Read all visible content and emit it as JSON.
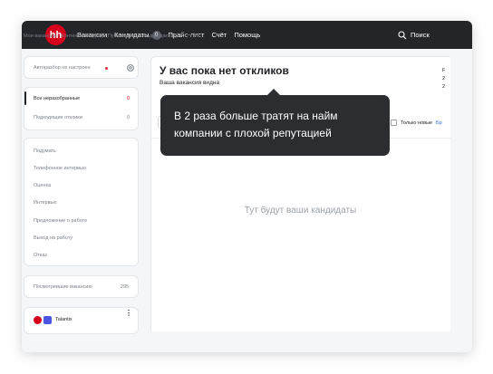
{
  "topbar": {
    "logo_text": "hh",
    "nav": [
      {
        "label": "Вакансии"
      },
      {
        "label": "Кандидаты",
        "count": "0"
      },
      {
        "label": "Прайс-лист"
      },
      {
        "label": "Счёт"
      },
      {
        "label": "Помощь"
      }
    ],
    "search_label": "Поиск"
  },
  "breadcrumb": {
    "items": [
      "Мои вакансии",
      "Контент-менеджер (Публикация, бильд-редактор)",
      "Отклики"
    ],
    "separator": "·"
  },
  "sidebar": {
    "autoparse_label": "Авторазбор не настроен",
    "filters": [
      {
        "label": "Все неразобранные",
        "count": "0"
      },
      {
        "label": "Подходящие отклики",
        "count": "0"
      }
    ],
    "stages": [
      "Подумать",
      "Телефонное интервью",
      "Оценка",
      "Интервью",
      "Предложение о работе",
      "Выход на работу",
      "Отказ"
    ],
    "viewed_label": "Посмотревшие вакансию",
    "viewed_count": "295",
    "integration_name": "Talantix",
    "more_glyph": "⋮"
  },
  "main": {
    "title": "У вас пока нет откликов",
    "subtitle": "Ваша вакансия видна",
    "right_peek": "F\n2\n2",
    "only_new_label": "Только новые",
    "only_new_link": "Бр",
    "empty_text": "Тут будут ваши кандидаты"
  },
  "tooltip": {
    "line1": "В 2 раза больше тратят на найм",
    "line2": "компании с плохой репутацией"
  },
  "colors": {
    "brand_red": "#d6001c",
    "topbar_bg": "#232529",
    "tooltip_bg": "#2b2d31",
    "link_blue": "#2f6fd9"
  },
  "icons": [
    "search-icon",
    "gear-icon",
    "more-vertical-icon",
    "hh-logo-icon",
    "talantix-icon"
  ]
}
